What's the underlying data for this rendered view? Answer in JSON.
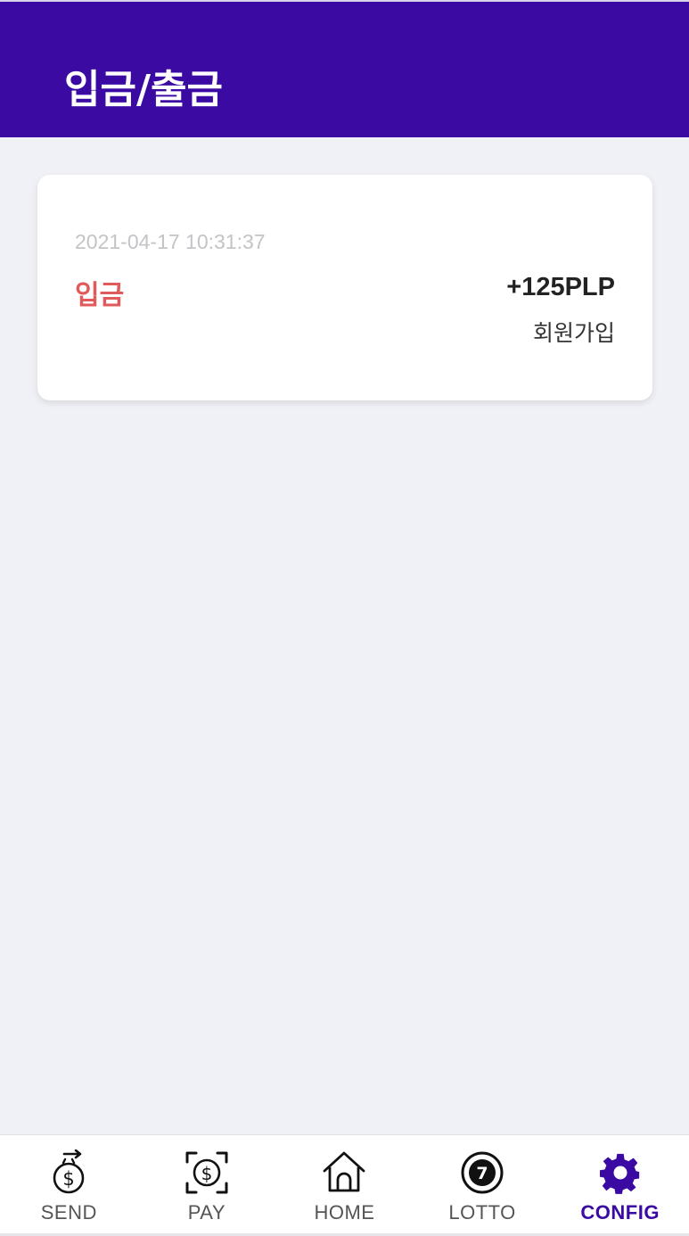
{
  "header": {
    "title": "입금/출금"
  },
  "transactions": [
    {
      "date": "2021-04-17 10:31:37",
      "type": "입금",
      "amount": "+125PLP",
      "description": "회원가입"
    }
  ],
  "tabs": [
    {
      "label": "SEND",
      "icon": "send-dollar-icon",
      "active": false
    },
    {
      "label": "PAY",
      "icon": "pay-scan-icon",
      "active": false
    },
    {
      "label": "HOME",
      "icon": "home-icon",
      "active": false
    },
    {
      "label": "LOTTO",
      "icon": "lotto-ball-icon",
      "active": false
    },
    {
      "label": "CONFIG",
      "icon": "gear-icon",
      "active": true
    }
  ],
  "colors": {
    "header_bg": "#3b0aa3",
    "deposit_red": "#e05a5a",
    "active_tab": "#3b0aa3",
    "page_bg": "#f0f1f6"
  }
}
